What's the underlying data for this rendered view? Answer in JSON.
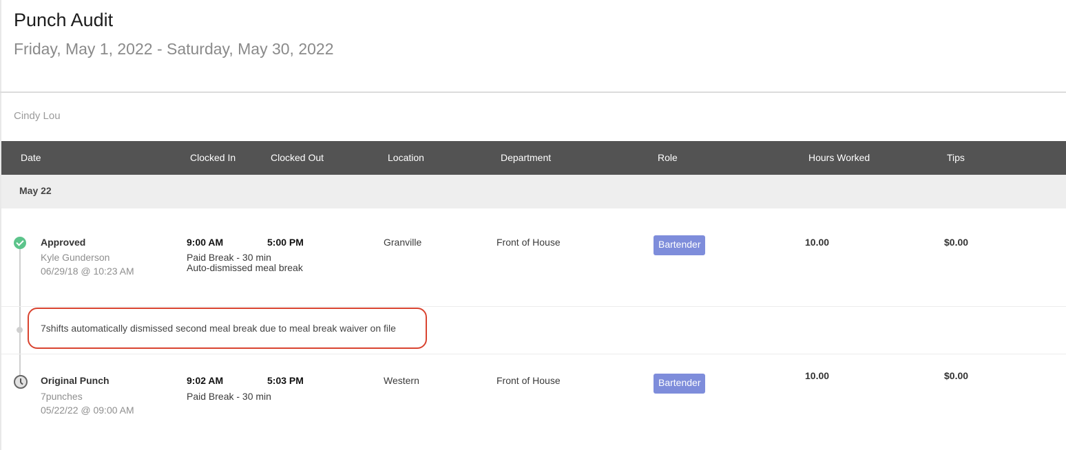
{
  "header": {
    "title": "Punch Audit",
    "date_range": "Friday, May 1, 2022 - Saturday, May 30, 2022"
  },
  "employee_name": "Cindy Lou",
  "table": {
    "columns": [
      "Date",
      "Clocked In",
      "Clocked Out",
      "Location",
      "Department",
      "Role",
      "Hours Worked",
      "Tips"
    ]
  },
  "day_group": "May 22",
  "punches": [
    {
      "status": "Approved",
      "by": "Kyle Gunderson",
      "timestamp": "06/29/18 @ 10:23 AM",
      "clocked_in": "9:00 AM",
      "clocked_out": "5:00 PM",
      "break_note": "Paid Break - 30 min",
      "extra_note": "Auto-dismissed meal break",
      "location": "Granville",
      "department": "Front of House",
      "role": "Bartender",
      "hours": "10.00",
      "tips": "$0.00"
    },
    {
      "status": "Original Punch",
      "by": "7punches",
      "timestamp": "05/22/22 @ 09:00 AM",
      "clocked_in": "9:02 AM",
      "clocked_out": "5:03 PM",
      "break_note": "Paid Break - 30 min",
      "location": "Western",
      "department": "Front of House",
      "role": "Bartender",
      "hours": "10.00",
      "tips": "$0.00"
    }
  ],
  "audit_note": "7shifts automatically dismissed second meal break due to meal break waiver on file",
  "colors": {
    "header_bg": "#535353",
    "approved": "#5cc48b",
    "role_badge": "#7e8ddb",
    "highlight": "#d9432f"
  },
  "icons": {
    "approved": "check-circle-icon",
    "note": "timeline-dot-icon",
    "original": "clock-icon"
  }
}
